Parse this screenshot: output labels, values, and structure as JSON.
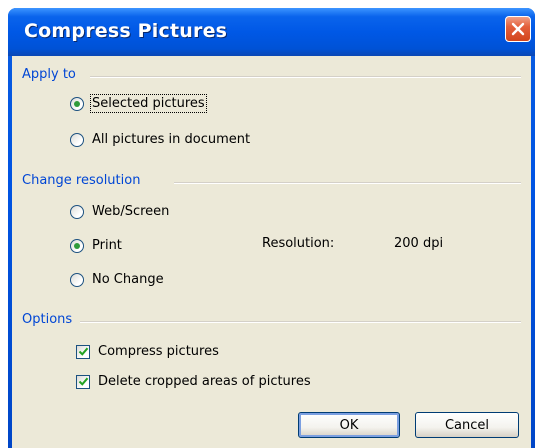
{
  "window": {
    "title": "Compress Pictures"
  },
  "apply_to": {
    "label": "Apply to",
    "options": [
      {
        "label": "Selected pictures",
        "selected": true
      },
      {
        "label": "All pictures in document",
        "selected": false
      }
    ]
  },
  "change_resolution": {
    "label": "Change resolution",
    "options": [
      {
        "label": "Web/Screen",
        "selected": false
      },
      {
        "label": "Print",
        "selected": true
      },
      {
        "label": "No Change",
        "selected": false
      }
    ],
    "resolution_label": "Resolution:",
    "resolution_value": "200 dpi"
  },
  "options": {
    "label": "Options",
    "checkboxes": [
      {
        "label": "Compress pictures",
        "checked": true
      },
      {
        "label": "Delete cropped areas of pictures",
        "checked": true
      }
    ]
  },
  "buttons": {
    "ok": "OK",
    "cancel": "Cancel"
  },
  "colors": {
    "title_bar": "#0058e6",
    "client_bg": "#ece9d8",
    "group_label": "#0046d5",
    "radio_dot": "#2f9b3a",
    "close_button": "#d2451d"
  },
  "icons": {
    "close": "close-icon",
    "check": "checkmark-icon"
  }
}
